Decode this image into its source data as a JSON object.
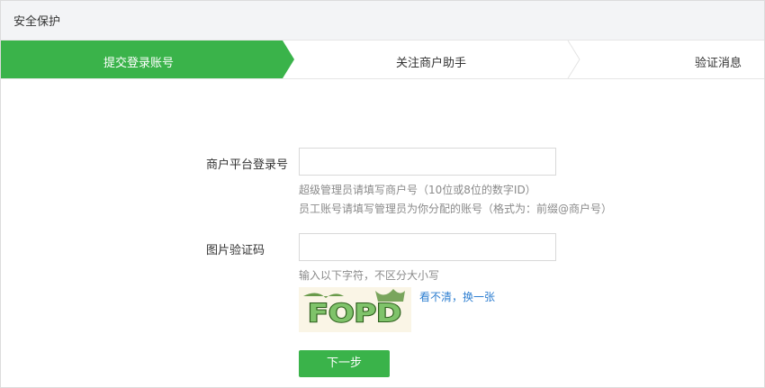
{
  "header": {
    "title": "安全保护"
  },
  "steps": [
    {
      "label": "提交登录账号",
      "active": true
    },
    {
      "label": "关注商户助手",
      "active": false
    },
    {
      "label": "验证消息",
      "active": false
    }
  ],
  "form": {
    "account": {
      "label": "商户平台登录号",
      "value": "",
      "hint_line1": "超级管理员请填写商户号（10位或8位的数字ID）",
      "hint_line2": "员工账号请填写管理员为你分配的账号（格式为：前缀@商户号）"
    },
    "captcha": {
      "label": "图片验证码",
      "value": "",
      "hint": "输入以下字符，不区分大小写",
      "image_text": "FOPD",
      "refresh_link": "看不清，换一张"
    },
    "next_button": "下一步"
  },
  "colors": {
    "accent": "#3ab34a",
    "link": "#2f7fd1",
    "hint": "#8a8a8a"
  }
}
